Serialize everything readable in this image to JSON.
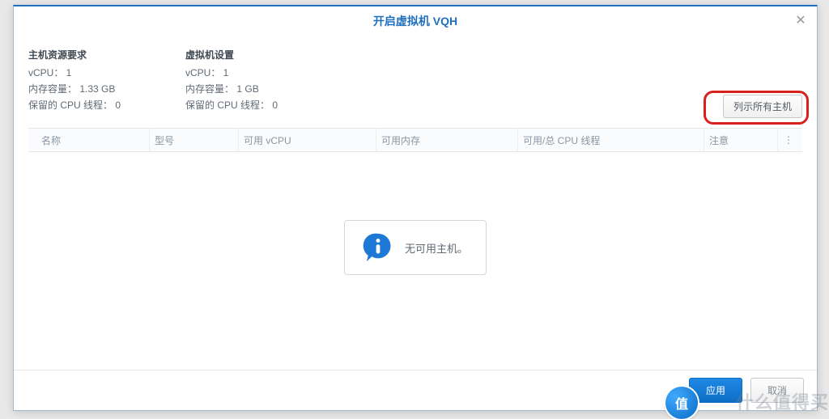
{
  "dialog": {
    "title": "开启虚拟机 VQH",
    "close_label": "✕"
  },
  "host_req": {
    "title": "主机资源要求",
    "vcpu": "vCPU： 1",
    "mem": "内存容量： 1.33 GB",
    "threads": "保留的 CPU 线程： 0"
  },
  "vm_set": {
    "title": "虚拟机设置",
    "vcpu": "vCPU： 1",
    "mem": "内存容量： 1 GB",
    "threads": "保留的 CPU 线程： 0"
  },
  "buttons": {
    "show_all_hosts": "列示所有主机",
    "apply": "应用",
    "cancel": "取消"
  },
  "table": {
    "columns": {
      "name": "名称",
      "model": "型号",
      "vcpu": "可用 vCPU",
      "mem": "可用内存",
      "threads": "可用/总 CPU 线程",
      "note": "注意",
      "more": "⋮"
    },
    "empty_message": "无可用主机。"
  },
  "overlay": {
    "badge": "值",
    "watermark": "什么值得买"
  }
}
